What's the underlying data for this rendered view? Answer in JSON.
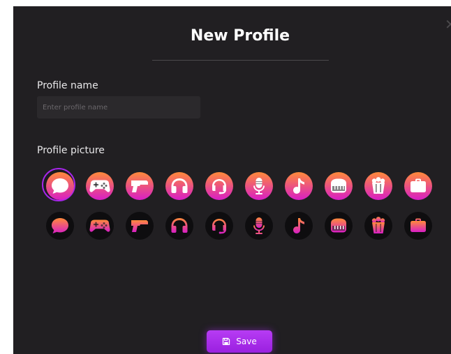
{
  "dialog": {
    "title": "New Profile",
    "close_glyph": "✕"
  },
  "profile_name": {
    "label": "Profile name",
    "placeholder": "Enter profile name",
    "value": ""
  },
  "profile_picture": {
    "label": "Profile picture",
    "icons": [
      "chat-bubble",
      "gamepad",
      "gun",
      "headphones",
      "headset",
      "microphone",
      "music-note",
      "piano",
      "popcorn",
      "briefcase"
    ],
    "rows": [
      {
        "style": "light",
        "selected_index": 0
      },
      {
        "style": "dark"
      }
    ]
  },
  "save_button": {
    "label": "Save",
    "icon": "floppy-disk-icon"
  },
  "colors": {
    "background": "#211f22",
    "accent": "#a626ea",
    "gradient_top": "#ff8a3a",
    "gradient_bottom": "#d81ec6"
  }
}
